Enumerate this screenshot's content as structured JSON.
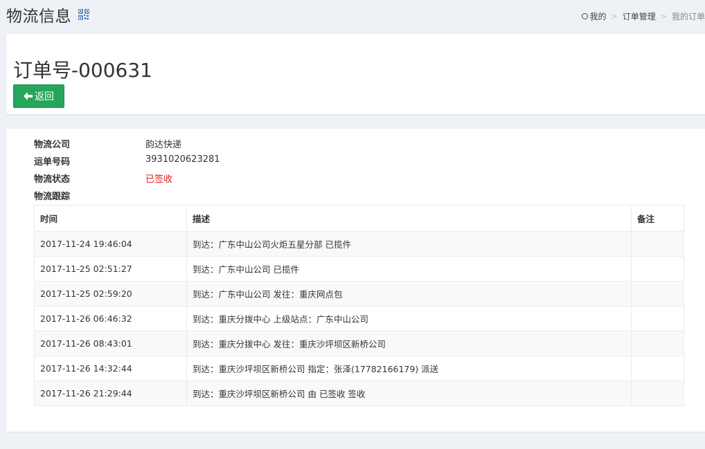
{
  "header": {
    "title": "物流信息",
    "breadcrumb": [
      "我的",
      "订单管理",
      "我的订单"
    ]
  },
  "order": {
    "title": "订单号-000631",
    "back_label": "返回"
  },
  "info": {
    "company_label": "物流公司",
    "company_value": "韵达快递",
    "waybill_label": "运单号码",
    "waybill_value": "3931020623281",
    "status_label": "物流状态",
    "status_value": "已签收",
    "tracking_label": "物流跟踪"
  },
  "table": {
    "headers": [
      "时间",
      "描述",
      "备注"
    ],
    "rows": [
      {
        "time": "2017-11-24 19:46:04",
        "desc": "到达：广东中山公司火炬五星分部 已揽件",
        "note": ""
      },
      {
        "time": "2017-11-25 02:51:27",
        "desc": "到达：广东中山公司 已揽件",
        "note": ""
      },
      {
        "time": "2017-11-25 02:59:20",
        "desc": "到达：广东中山公司 发往：重庆网点包",
        "note": ""
      },
      {
        "time": "2017-11-26 06:46:32",
        "desc": "到达：重庆分拨中心 上级站点：广东中山公司",
        "note": ""
      },
      {
        "time": "2017-11-26 08:43:01",
        "desc": "到达：重庆分拨中心 发往：重庆沙坪坝区新桥公司",
        "note": ""
      },
      {
        "time": "2017-11-26 14:32:44",
        "desc": "到达：重庆沙坪坝区新桥公司 指定：张泽(17782166179) 派送",
        "note": ""
      },
      {
        "time": "2017-11-26 21:29:44",
        "desc": "到达：重庆沙坪坝区新桥公司 由 已签收 签收",
        "note": ""
      }
    ]
  },
  "colors": {
    "button_green": "#26a65b",
    "status_red": "#e02222",
    "page_bg": "#eef1f5"
  },
  "icons": {
    "title_icon": "qrcode-icon",
    "back_icon": "arrow-left-icon",
    "breadcrumb_icon": "circle-icon"
  }
}
